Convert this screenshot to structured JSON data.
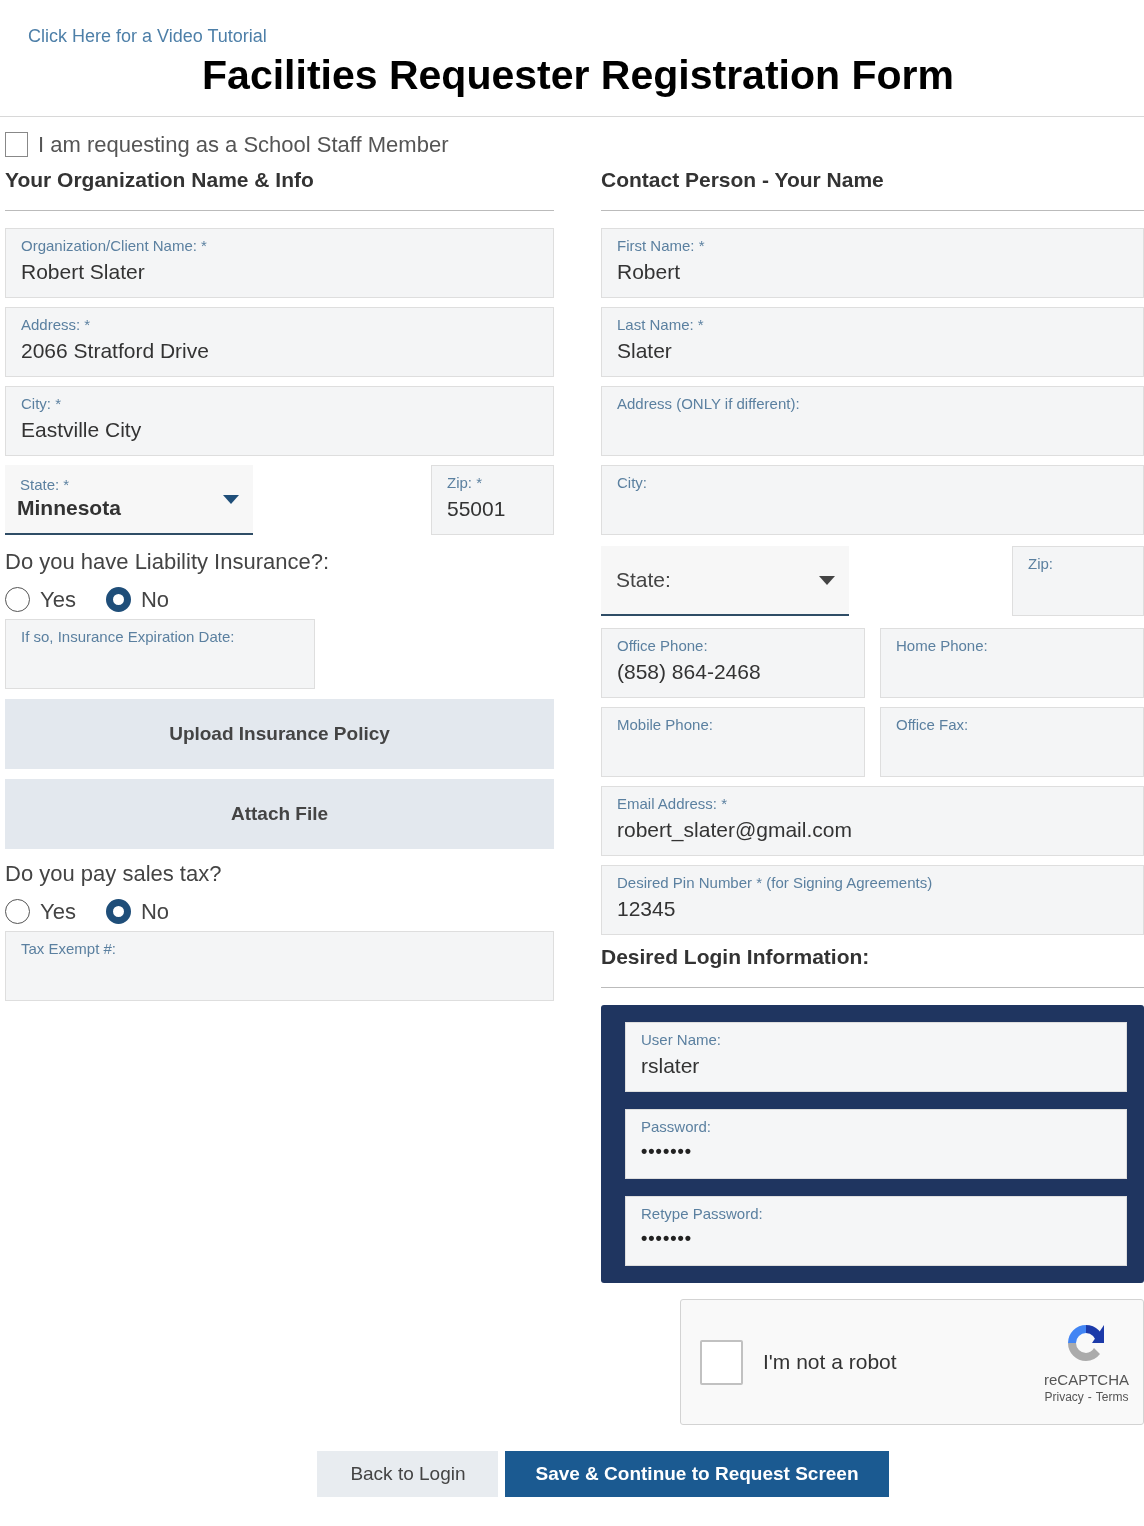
{
  "tutorial_link": "Click Here for a Video Tutorial",
  "title": "Facilities Requester Registration Form",
  "staff_checkbox": {
    "label": "I am requesting as a School Staff Member",
    "checked": false
  },
  "organization": {
    "heading": "Your Organization Name & Info",
    "items": [
      {
        "kind": "field",
        "label": "Organization/Client Name: *",
        "value": "Robert Slater"
      },
      {
        "kind": "field",
        "label": "Address: *",
        "value": "2066 Stratford Drive"
      },
      {
        "kind": "field",
        "label": "City: *",
        "value": "Eastville City"
      },
      {
        "kind": "select_zip",
        "select": {
          "label": "State: *",
          "value": "Minnesota"
        },
        "zip": {
          "label": "Zip: *",
          "value": "55001"
        }
      },
      {
        "kind": "question",
        "text": "Do you have Liability Insurance?:"
      },
      {
        "kind": "radios",
        "options": [
          {
            "label": "Yes",
            "selected": false
          },
          {
            "label": "No",
            "selected": true
          }
        ]
      },
      {
        "kind": "short_field",
        "label": "If so, Insurance Expiration Date:"
      },
      {
        "kind": "button",
        "label": "Upload Insurance Policy"
      },
      {
        "kind": "button",
        "label": "Attach File"
      },
      {
        "kind": "question",
        "text": "Do you pay sales tax?"
      },
      {
        "kind": "radios",
        "options": [
          {
            "label": "Yes",
            "selected": false
          },
          {
            "label": "No",
            "selected": true
          }
        ]
      },
      {
        "kind": "field",
        "label": "Tax Exempt #:"
      }
    ]
  },
  "contact": {
    "heading": "Contact Person - Your Name",
    "items": [
      {
        "kind": "field",
        "label": "First Name: *",
        "value": "Robert"
      },
      {
        "kind": "field",
        "label": "Last Name: *",
        "value": "Slater"
      },
      {
        "kind": "field",
        "label": "Address (ONLY if different):"
      },
      {
        "kind": "field",
        "label": "City:"
      },
      {
        "kind": "select_zip",
        "select": {
          "placeholder": "State:"
        },
        "zip": {
          "label": "Zip:"
        }
      },
      {
        "kind": "pair",
        "fields": [
          {
            "label": "Office Phone:",
            "value": "(858) 864-2468"
          },
          {
            "label": "Home Phone:"
          }
        ]
      },
      {
        "kind": "pair",
        "fields": [
          {
            "label": "Mobile Phone:"
          },
          {
            "label": "Office Fax:"
          }
        ]
      },
      {
        "kind": "field",
        "label": "Email Address: *",
        "value": "robert_slater@gmail.com"
      },
      {
        "kind": "field",
        "label": "Desired Pin Number * (for Signing Agreements)",
        "value": "12345"
      }
    ]
  },
  "login": {
    "heading": "Desired Login Information:",
    "fields": [
      {
        "kind": "text",
        "label": "User Name:",
        "value": "rslater"
      },
      {
        "kind": "password",
        "label": "Password:",
        "value": "•••••••"
      },
      {
        "kind": "password",
        "label": "Retype Password:",
        "value": "•••••••"
      }
    ]
  },
  "recaptcha": {
    "label": "I'm not a robot",
    "checked": false,
    "brand": "reCAPTCHA",
    "privacy": "Privacy",
    "separator": "-",
    "terms": "Terms"
  },
  "buttons": [
    {
      "kind": "secondary",
      "label": "Back to Login"
    },
    {
      "kind": "primary",
      "label": "Save & Continue to Request Screen"
    }
  ]
}
